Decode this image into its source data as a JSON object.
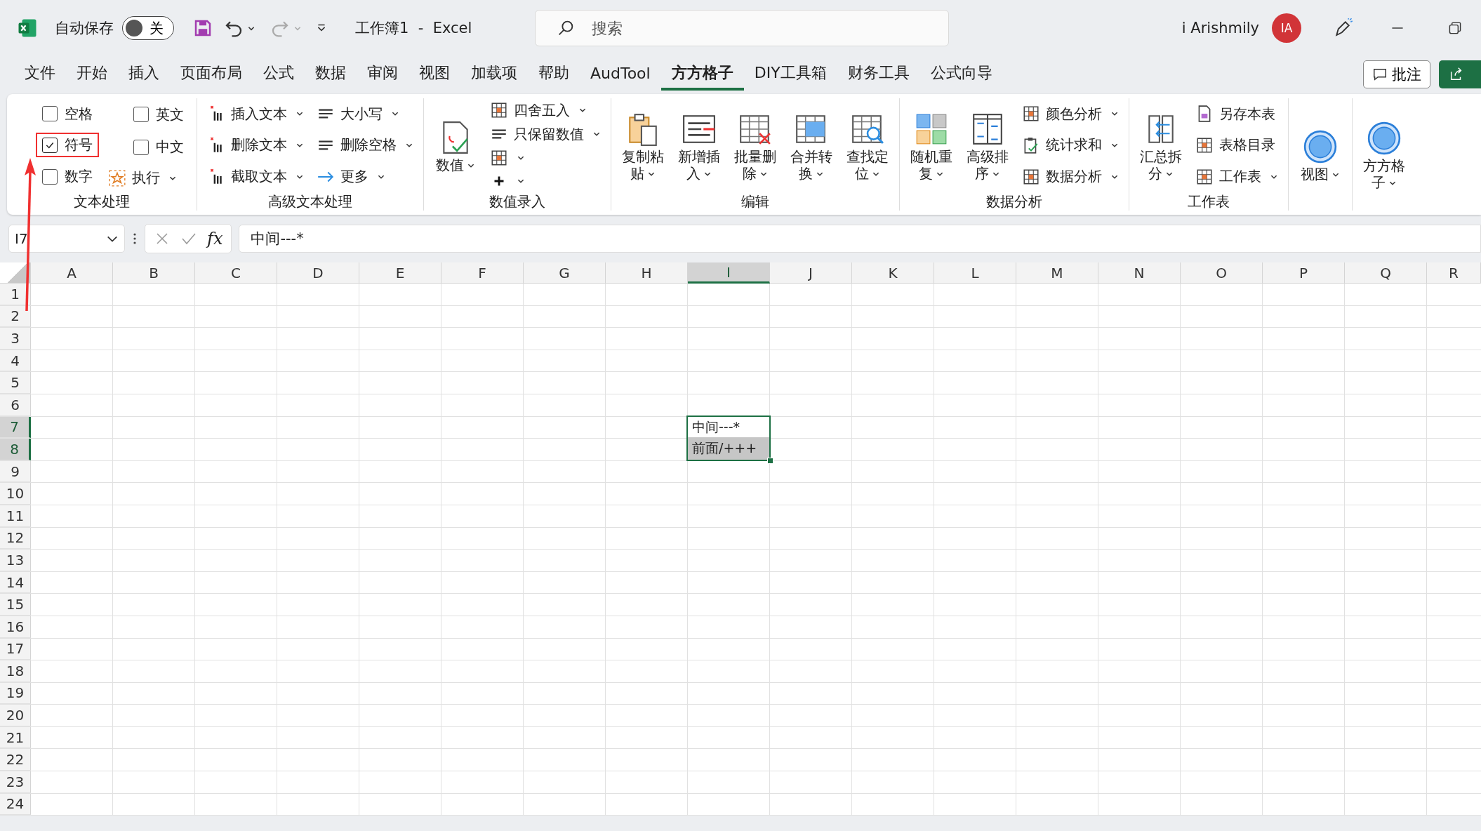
{
  "title_bar": {
    "autosave_label": "自动保存",
    "autosave": {
      "label": "关",
      "on": false
    },
    "title": "工作簿1  -  Excel",
    "search": {
      "placeholder": "搜索"
    },
    "user": "i Arishmily",
    "avatar": "IA"
  },
  "menu_tabs": [
    {
      "label": "文件",
      "selected": false
    },
    {
      "label": "开始",
      "selected": false
    },
    {
      "label": "插入",
      "selected": false
    },
    {
      "label": "页面布局",
      "selected": false
    },
    {
      "label": "公式",
      "selected": false
    },
    {
      "label": "数据",
      "selected": false
    },
    {
      "label": "审阅",
      "selected": false
    },
    {
      "label": "视图",
      "selected": false
    },
    {
      "label": "加载项",
      "selected": false
    },
    {
      "label": "帮助",
      "selected": false
    },
    {
      "label": "AudTool",
      "selected": false
    },
    {
      "label": "方方格子",
      "selected": true
    },
    {
      "label": "DIY工具箱",
      "selected": false
    },
    {
      "label": "财务工具",
      "selected": false
    },
    {
      "label": "公式向导",
      "selected": false
    }
  ],
  "comment_button": "批注",
  "ribbon_groups": [
    {
      "label": "文本处理",
      "columns": [
        [
          {
            "kind": "checkbox",
            "label": "空格",
            "checked": false,
            "annotated": false
          },
          {
            "kind": "checkbox",
            "label": "符号",
            "checked": true,
            "annotated": true
          },
          {
            "kind": "checkbox",
            "label": "数字",
            "checked": false,
            "annotated": false
          }
        ],
        [
          {
            "kind": "checkbox",
            "label": "英文",
            "checked": false,
            "annotated": false
          },
          {
            "kind": "checkbox",
            "label": "中文",
            "checked": false,
            "annotated": false
          },
          {
            "kind": "small",
            "label": "执行",
            "dropdown": true
          }
        ]
      ]
    },
    {
      "label": "高级文本处理",
      "columns": [
        [
          {
            "kind": "small",
            "label": "插入文本",
            "dropdown": true
          },
          {
            "kind": "small",
            "label": "删除文本",
            "dropdown": true
          },
          {
            "kind": "small",
            "label": "截取文本",
            "dropdown": true
          }
        ],
        [
          {
            "kind": "small",
            "label": "大小写",
            "dropdown": true
          },
          {
            "kind": "small",
            "label": "删除空格",
            "dropdown": true
          },
          {
            "kind": "small",
            "label": "更多",
            "dropdown": true
          }
        ]
      ]
    },
    {
      "label": "数值录入",
      "columns": [
        [
          {
            "kind": "large",
            "label": "数值",
            "dropdown": true
          }
        ],
        [
          {
            "kind": "small",
            "label": "四舍五入",
            "dropdown": true
          },
          {
            "kind": "small",
            "label": "只保留数值",
            "dropdown": true
          },
          {
            "kind": "small",
            "dropdown": true
          },
          {
            "kind": "small",
            "dropdown": true
          }
        ]
      ]
    },
    {
      "label": "编辑",
      "columns": [
        [
          {
            "kind": "large",
            "label": "复制粘贴",
            "dropdown": true
          }
        ],
        [
          {
            "kind": "large",
            "label": "新增插入",
            "dropdown": true
          }
        ],
        [
          {
            "kind": "large",
            "label": "批量删除",
            "dropdown": true
          }
        ],
        [
          {
            "kind": "large",
            "label": "合并转换",
            "dropdown": true
          }
        ],
        [
          {
            "kind": "large",
            "label": "查找定位",
            "dropdown": true
          }
        ]
      ]
    },
    {
      "label": "数据分析",
      "columns": [
        [
          {
            "kind": "large",
            "label": "随机重复",
            "dropdown": true
          }
        ],
        [
          {
            "kind": "large",
            "label": "高级排序",
            "dropdown": true
          }
        ],
        [
          {
            "kind": "small",
            "label": "颜色分析",
            "dropdown": true
          },
          {
            "kind": "small",
            "label": "统计求和",
            "dropdown": true
          },
          {
            "kind": "small",
            "label": "数据分析",
            "dropdown": true
          }
        ]
      ]
    },
    {
      "label": "工作表",
      "columns": [
        [
          {
            "kind": "large",
            "label": "汇总拆分",
            "dropdown": true
          }
        ],
        [
          {
            "kind": "small",
            "label": "另存本表",
            "dropdown": false
          },
          {
            "kind": "small",
            "label": "表格目录",
            "dropdown": false
          },
          {
            "kind": "small",
            "label": "工作表",
            "dropdown": true
          }
        ]
      ]
    },
    {
      "columns": [
        [
          {
            "kind": "large",
            "label": "视图",
            "dropdown": true
          }
        ]
      ]
    },
    {
      "columns": [
        [
          {
            "kind": "large",
            "label": "方方格子",
            "dropdown": true
          }
        ]
      ]
    }
  ],
  "formula_bar": {
    "name_box": "I7",
    "function_label": "fx",
    "formula": "中间---*"
  },
  "sheet": {
    "columns": [
      {
        "label": "A",
        "selected": false
      },
      {
        "label": "B",
        "selected": false
      },
      {
        "label": "C",
        "selected": false
      },
      {
        "label": "D",
        "selected": false
      },
      {
        "label": "E",
        "selected": false
      },
      {
        "label": "F",
        "selected": false
      },
      {
        "label": "G",
        "selected": false
      },
      {
        "label": "H",
        "selected": false
      },
      {
        "label": "I",
        "selected": true
      },
      {
        "label": "J",
        "selected": false
      },
      {
        "label": "K",
        "selected": false
      },
      {
        "label": "L",
        "selected": false
      },
      {
        "label": "M",
        "selected": false
      },
      {
        "label": "N",
        "selected": false
      },
      {
        "label": "O",
        "selected": false
      },
      {
        "label": "P",
        "selected": false
      },
      {
        "label": "Q",
        "selected": false
      },
      {
        "label": "R",
        "selected": false
      }
    ],
    "rows": [
      {
        "number": "1",
        "selected": false
      },
      {
        "number": "2",
        "selected": false
      },
      {
        "number": "3",
        "selected": false
      },
      {
        "number": "4",
        "selected": false
      },
      {
        "number": "5",
        "selected": false
      },
      {
        "number": "6",
        "selected": false
      },
      {
        "number": "7",
        "selected": true,
        "cells": [
          null,
          null,
          null,
          null,
          null,
          null,
          null,
          null,
          {
            "text": "中间---*",
            "active": true
          }
        ]
      },
      {
        "number": "8",
        "selected": true,
        "cells": [
          null,
          null,
          null,
          null,
          null,
          null,
          null,
          null,
          {
            "text": "前面/+++",
            "active": false
          }
        ]
      },
      {
        "number": "9",
        "selected": false
      },
      {
        "number": "10",
        "selected": false
      },
      {
        "number": "11",
        "selected": false
      },
      {
        "number": "12",
        "selected": false
      },
      {
        "number": "13",
        "selected": false
      },
      {
        "number": "14",
        "selected": false
      },
      {
        "number": "15",
        "selected": false
      },
      {
        "number": "16",
        "selected": false
      },
      {
        "number": "17",
        "selected": false
      },
      {
        "number": "18",
        "selected": false
      },
      {
        "number": "19",
        "selected": false
      },
      {
        "number": "20",
        "selected": false
      },
      {
        "number": "21",
        "selected": false
      },
      {
        "number": "22",
        "selected": false
      },
      {
        "number": "23",
        "selected": false
      },
      {
        "number": "24",
        "selected": false
      }
    ]
  }
}
